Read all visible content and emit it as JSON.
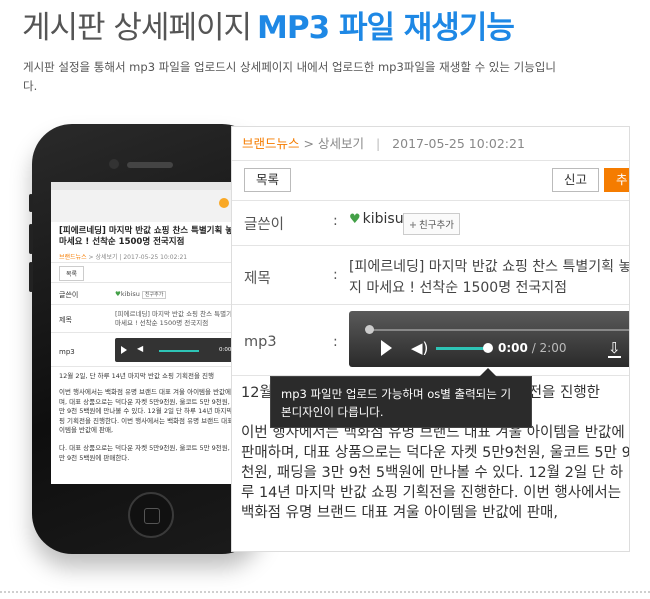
{
  "heading": {
    "part1": "게시판 상세페이지",
    "part2": "MP3 파일 재생기능"
  },
  "description": "게시판 설정을 통해서 mp3 파일을 업로드시 상세페이지 내에서 업로드한 mp3파일을 재생할 수 있는 기능입니다.",
  "colors": {
    "accent_blue": "#1e88e5",
    "orange": "#f57c00",
    "teal": "#2ec4b6"
  },
  "post": {
    "breadcrumb": {
      "category": "브랜드뉴스",
      "current": "상세보기",
      "sep": "|",
      "datetime": "2017-05-25 10:02:21"
    },
    "buttons": {
      "list": "목록",
      "report": "신고",
      "recommend": "추"
    },
    "labels": {
      "author": "글쓴이",
      "subject": "제목",
      "mp3": "mp3",
      "colon": ":"
    },
    "author": {
      "name": "kibisu",
      "friend_add": "친구추가"
    },
    "subject": "[피에르네딩] 마지막 반값 쇼핑 찬스 특별기획 놓치지 마세요 ! 선착순 1500명 전국지점",
    "player": {
      "current": "0:00",
      "total": "/ 2:00"
    },
    "body": [
      "12월 2일, 단 하루 14년 마지막 반값 쇼핑 기획전을 진행한",
      "이번 행사에서는 백화점 유명 브랜드 대표 겨울 아이템을 반값에 판매하며, 대표 상품으로는 덕다운 자켓 5만9천원, 울코트 5만 9천원, 패딩을 3만 9천 5백원에 만나볼 수 있다. 12월 2일 단 하루 14년 마지막 반값 쇼핑 기획전을 진행한다. 이번 행사에서는 백화점 유명 브랜드 대표 겨울 아이템을 반값에 판매,"
    ]
  },
  "tooltip": "mp3 파일만 업로드 가능하며 os별 출력되는 기본디자인이 다릅니다.",
  "mobile": {
    "title": "[피에르네딩] 마지막 반값 쇼핑 찬스 특별기획 놓치지 마세요 ! 선착순 1500명 전국지점",
    "crumb_cat": "브랜드뉴스",
    "crumb_rest": " > 상세보기 | 2017-05-25 10:02:21",
    "btn_list": "목록",
    "btn_report": "신",
    "author_name": "kibisu",
    "friend_add": "친구추가",
    "subject": "[피에르네딩] 마지막 반값 쇼핑 찬스 특별기획 놓치지 마세요 ! 선착순 1500명 전국지점",
    "time": "0:00 / 2:00",
    "body1": "12월 2일, 단 하루 14년 마지막 반값 쇼핑 기획전을 진행",
    "body2": "이번 행사에서는 백화점 유명 브랜드 대표 겨울 아이템을 반값에 판매하며, 대표 상품으로는 덕다운 자켓 5만9천원, 울코트 5만 9천원, 패딩을 3만 9천 5백원에 만나볼 수 있다. 12월 2일 단 하루 14년 마지막 반값 쇼핑 기획전을 진행한다. 이번 행사에서는 백화점 유명 브랜드 대표 겨울 아이템을 반값에 판매,",
    "body3": "다. 대표 상품으로는 덕다운 자켓 5만9천원, 울코트 5만 9천원, 패딩을 3만 9천 5백원에 판매한다."
  }
}
